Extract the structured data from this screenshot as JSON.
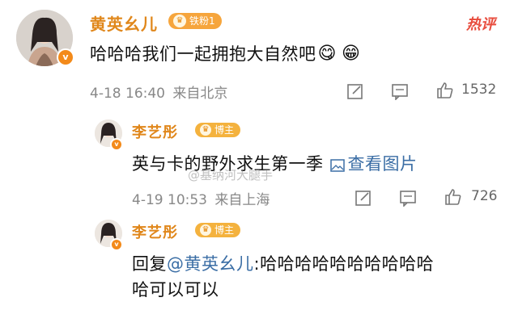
{
  "post": {
    "user_name": "黄英幺儿",
    "fan_badge": "铁粉1",
    "hot_label": "热评",
    "text": "哈哈哈我们一起拥抱大自然吧",
    "emojis": [
      "😋",
      "😁"
    ],
    "date": "4-18",
    "time": "16:40",
    "source": "来自北京",
    "like_count": "1532"
  },
  "reply1": {
    "user_name": "李艺彤",
    "badge": "博主",
    "text": "英与卡的野外求生第一季",
    "image_link_label": "查看图片",
    "date": "4-19",
    "time": "10:53",
    "source": "来自上海",
    "like_count": "726",
    "watermark": "@基纳河大腿手"
  },
  "reply2": {
    "user_name": "李艺彤",
    "badge": "博主",
    "reply_prefix": "回复",
    "mention": "@黄英幺儿",
    "text_line1": ":哈哈哈哈哈哈哈哈哈哈",
    "text_line2": "哈可以可以"
  },
  "colors": {
    "name": "#e0871b",
    "hot": "#e84c3d",
    "link": "#3b6ea5",
    "meta": "#888888"
  },
  "icons": [
    "verified-icon",
    "share-icon",
    "comment-icon",
    "like-icon",
    "image-icon",
    "crown-icon"
  ]
}
